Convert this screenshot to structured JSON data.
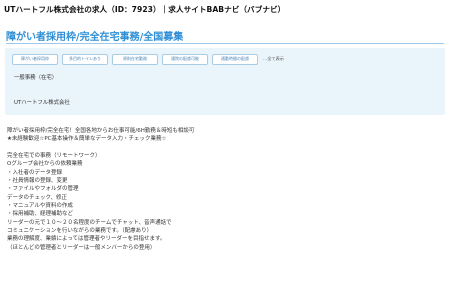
{
  "header": {
    "title": "UTハートフル株式会社の求人（ID：7923）｜求人サイトBABナビ（バブナビ）"
  },
  "job": {
    "title": "障がい者採用枠/完全在宅事務/全国募集",
    "tags": [
      "障がい者採用枠",
      "多目的トイレあり",
      "原則在宅勤務",
      "通院の配慮可能",
      "通勤時間の配慮"
    ],
    "tags_more": "…全て表示",
    "job_type": "一般事務（在宅）",
    "company": "UTハートフル株式会社"
  },
  "description": {
    "lines": [
      "障がい者採用枠/完全在宅！全国各地からお仕事可能/6H勤務＆時短も相談可",
      "★未経験歓迎☆PC基本操作＆簡単なデータ入力・チェック業務☆",
      "",
      "完全在宅での事務（リモートワーク）",
      "Oグループ会社からの依頼業務",
      "・入社者のデータ登録",
      "・社員情報の登録、変更",
      "・ファイルやフォルダの管理",
      "データのチェック、修正",
      "・マニュアルや資料の作成",
      "・採用補助、経理補助など",
      "リーダーの元で１０～２０名程度のチームでチャット、音声通話で",
      "コミュニケーションを行いながらの業務です。（配慮あり）",
      "業務の理解度、業績によっては管理者やリーダーを目指せます。",
      "（ほとんどの管理者とリーダーは一般メンバーからの登用）"
    ]
  },
  "colors": {
    "accent": "#2e8fd6",
    "panel_bg": "#eaf4fb",
    "tag_border": "#a8cbe6"
  }
}
